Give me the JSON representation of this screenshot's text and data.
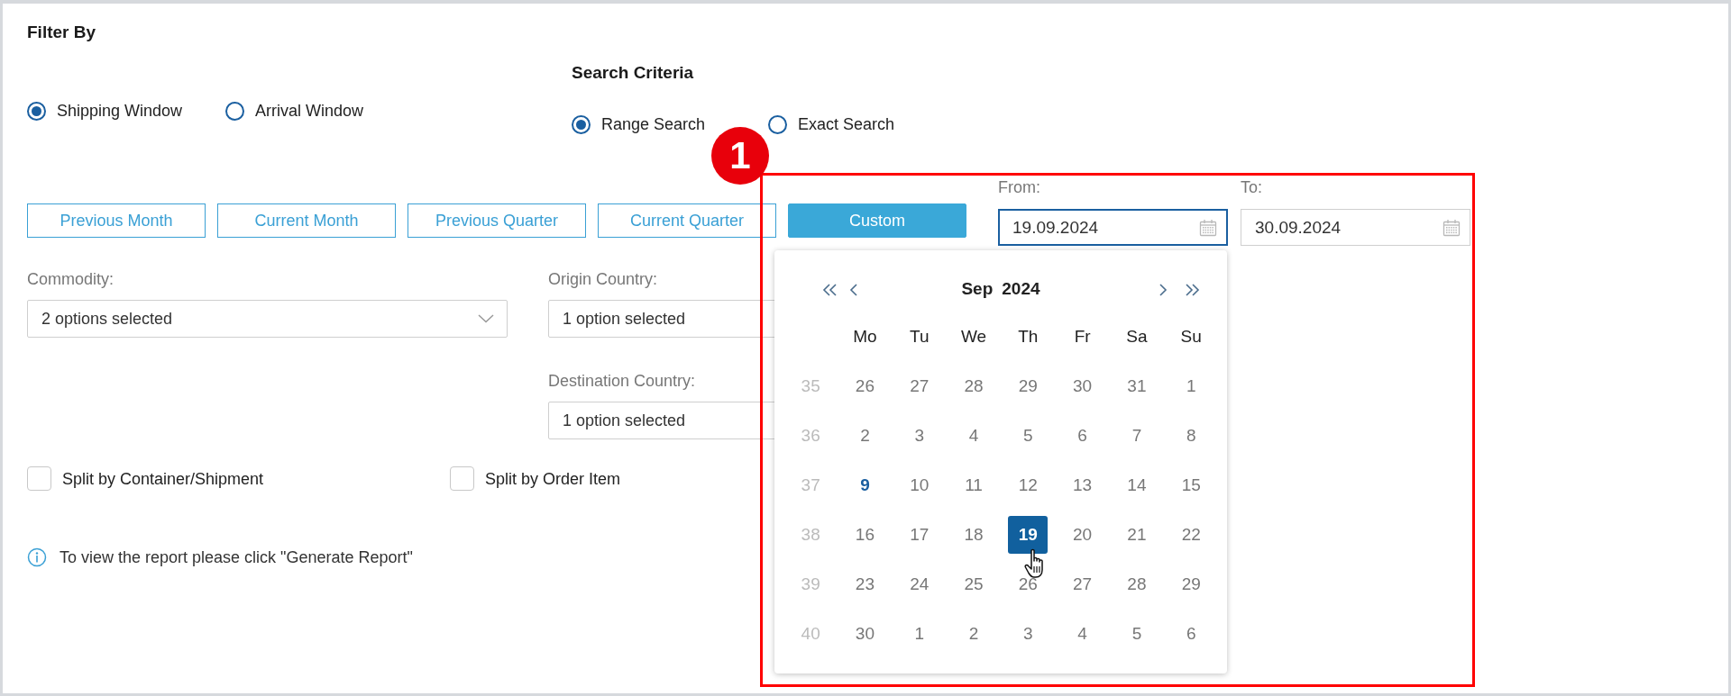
{
  "title": "Filter By",
  "filter_window": [
    {
      "label": "Shipping Window",
      "selected": true
    },
    {
      "label": "Arrival Window",
      "selected": false
    }
  ],
  "search_criteria": {
    "title": "Search Criteria",
    "options": [
      {
        "label": "Range Search",
        "selected": true
      },
      {
        "label": "Exact Search",
        "selected": false
      }
    ]
  },
  "period_buttons": [
    {
      "label": "Previous Month",
      "selected": false
    },
    {
      "label": "Current Month",
      "selected": false
    },
    {
      "label": "Previous Quarter",
      "selected": false
    },
    {
      "label": "Current Quarter",
      "selected": false
    },
    {
      "label": "Custom",
      "selected": true
    }
  ],
  "date_range": {
    "from": {
      "label": "From:",
      "value": "19.09.2024",
      "focused": true
    },
    "to": {
      "label": "To:",
      "value": "30.09.2024",
      "focused": false
    }
  },
  "commodity": {
    "label": "Commodity:",
    "value": "2 options selected"
  },
  "origin_country": {
    "label": "Origin Country:",
    "value": "1 option selected"
  },
  "destination_country": {
    "label": "Destination Country:",
    "value": "1 option selected"
  },
  "checkboxes": [
    {
      "label": "Split by Container/Shipment",
      "checked": false
    },
    {
      "label": "Split by Order Item",
      "checked": false
    }
  ],
  "info": "To view the report please click \"Generate Report\"",
  "calendar": {
    "month": "Sep",
    "year": "2024",
    "weekdays": [
      "Mo",
      "Tu",
      "We",
      "Th",
      "Fr",
      "Sa",
      "Su"
    ],
    "weeks": [
      {
        "number": "35",
        "days": [
          {
            "label": "26",
            "selected": false,
            "today": false
          },
          {
            "label": "27",
            "selected": false,
            "today": false
          },
          {
            "label": "28",
            "selected": false,
            "today": false
          },
          {
            "label": "29",
            "selected": false,
            "today": false
          },
          {
            "label": "30",
            "selected": false,
            "today": false
          },
          {
            "label": "31",
            "selected": false,
            "today": false
          },
          {
            "label": "1",
            "selected": false,
            "today": false
          }
        ]
      },
      {
        "number": "36",
        "days": [
          {
            "label": "2",
            "selected": false,
            "today": false
          },
          {
            "label": "3",
            "selected": false,
            "today": false
          },
          {
            "label": "4",
            "selected": false,
            "today": false
          },
          {
            "label": "5",
            "selected": false,
            "today": false
          },
          {
            "label": "6",
            "selected": false,
            "today": false
          },
          {
            "label": "7",
            "selected": false,
            "today": false
          },
          {
            "label": "8",
            "selected": false,
            "today": false
          }
        ]
      },
      {
        "number": "37",
        "days": [
          {
            "label": "9",
            "selected": false,
            "today": true
          },
          {
            "label": "10",
            "selected": false,
            "today": false
          },
          {
            "label": "11",
            "selected": false,
            "today": false
          },
          {
            "label": "12",
            "selected": false,
            "today": false
          },
          {
            "label": "13",
            "selected": false,
            "today": false
          },
          {
            "label": "14",
            "selected": false,
            "today": false
          },
          {
            "label": "15",
            "selected": false,
            "today": false
          }
        ]
      },
      {
        "number": "38",
        "days": [
          {
            "label": "16",
            "selected": false,
            "today": false
          },
          {
            "label": "17",
            "selected": false,
            "today": false
          },
          {
            "label": "18",
            "selected": false,
            "today": false
          },
          {
            "label": "19",
            "selected": true,
            "today": false
          },
          {
            "label": "20",
            "selected": false,
            "today": false
          },
          {
            "label": "21",
            "selected": false,
            "today": false
          },
          {
            "label": "22",
            "selected": false,
            "today": false
          }
        ]
      },
      {
        "number": "39",
        "days": [
          {
            "label": "23",
            "selected": false,
            "today": false
          },
          {
            "label": "24",
            "selected": false,
            "today": false
          },
          {
            "label": "25",
            "selected": false,
            "today": false
          },
          {
            "label": "26",
            "selected": false,
            "today": false
          },
          {
            "label": "27",
            "selected": false,
            "today": false
          },
          {
            "label": "28",
            "selected": false,
            "today": false
          },
          {
            "label": "29",
            "selected": false,
            "today": false
          }
        ]
      },
      {
        "number": "40",
        "days": [
          {
            "label": "30",
            "selected": false,
            "today": false
          },
          {
            "label": "1",
            "selected": false,
            "today": false
          },
          {
            "label": "2",
            "selected": false,
            "today": false
          },
          {
            "label": "3",
            "selected": false,
            "today": false
          },
          {
            "label": "4",
            "selected": false,
            "today": false
          },
          {
            "label": "5",
            "selected": false,
            "today": false
          },
          {
            "label": "6",
            "selected": false,
            "today": false
          }
        ]
      }
    ]
  },
  "annotation": {
    "number": "1"
  }
}
